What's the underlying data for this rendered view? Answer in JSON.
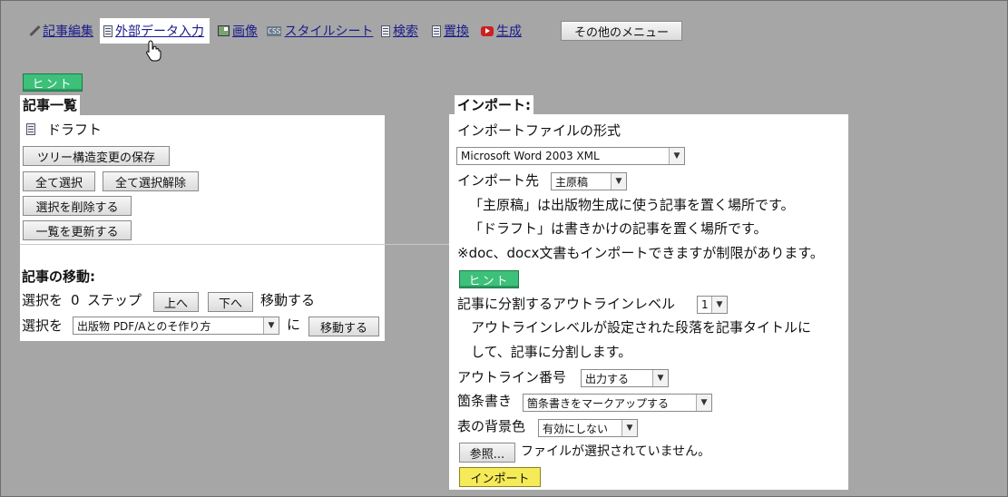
{
  "menu": {
    "items": [
      {
        "label": "記事編集",
        "icon": "pencil-icon"
      },
      {
        "label": "外部データ入力",
        "icon": "document-icon"
      },
      {
        "label": "画像",
        "icon": "image-icon"
      },
      {
        "label": "スタイルシート",
        "icon": "css-icon"
      },
      {
        "label": "検索",
        "icon": "document-icon"
      },
      {
        "label": "置換",
        "icon": "document-icon"
      },
      {
        "label": "生成",
        "icon": "video-icon"
      }
    ],
    "other_menu": "その他のメニュー"
  },
  "hint_label": "ヒント",
  "left": {
    "title": "記事一覧",
    "draft": "ドラフト",
    "save_tree": "ツリー構造変更の保存",
    "select_all": "全て選択",
    "deselect_all": "全て選択解除",
    "delete_selected": "選択を削除する",
    "refresh": "一覧を更新する",
    "move_title": "記事の移動:",
    "step_prefix": "選択を",
    "step_count": "0",
    "step_suffix": "ステップ",
    "up": "上へ",
    "down": "下へ",
    "move_suffix": "移動する",
    "select_prefix": "選択を",
    "dest_value": "出版物 PDF/Aとのそ作り方",
    "ni": "に",
    "move_button": "移動する"
  },
  "right": {
    "title": "インポート:",
    "format_label": "インポートファイルの形式",
    "format_value": "Microsoft Word 2003 XML",
    "dest_label": "インポート先",
    "dest_value": "主原稿",
    "note1": "「主原稿」は出版物生成に使う記事を置く場所です。",
    "note2": "「ドラフト」は書きかけの記事を置く場所です。",
    "note3": "※doc、docx文書もインポートできますが制限があります。",
    "outline_label": "記事に分割するアウトラインレベル",
    "outline_value": "1",
    "outline_note1": "アウトラインレベルが設定された段落を記事タイトルに",
    "outline_note2": "して、記事に分割します。",
    "number_label": "アウトライン番号",
    "number_value": "出力する",
    "bullet_label": "箇条書き",
    "bullet_value": "箇条書きをマークアップする",
    "table_label": "表の背景色",
    "table_value": "有効にしない",
    "browse": "参照...",
    "no_file": "ファイルが選択されていません。",
    "import_button": "インポート"
  },
  "colors": {
    "background": "#a6a6a6",
    "hint_green": "#3cc07a",
    "import_yellow": "#f5ea57",
    "link": "#1a1a8c"
  }
}
